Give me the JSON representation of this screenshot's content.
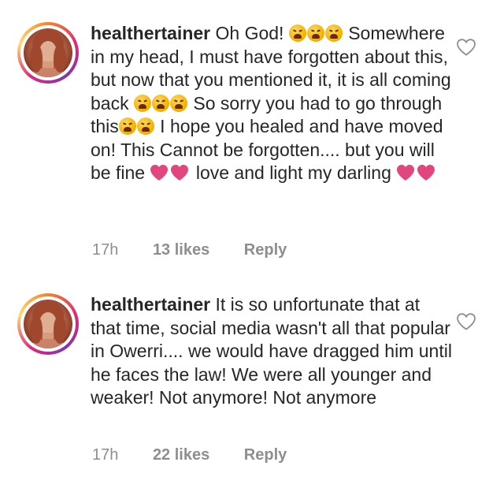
{
  "comments": [
    {
      "username": "healthertainer",
      "segments": [
        {
          "type": "text",
          "value": "Oh God! "
        },
        {
          "type": "emoji",
          "name": "crying-face",
          "count": 3
        },
        {
          "type": "text",
          "value": " Somewhere in my head, I must have forgotten about this, but now that you mentioned it, it is all coming back "
        },
        {
          "type": "emoji",
          "name": "crying-face",
          "count": 3
        },
        {
          "type": "text",
          "value": " So sorry you had to go through this"
        },
        {
          "type": "emoji",
          "name": "crying-face",
          "count": 2
        },
        {
          "type": "text",
          "value": " I hope you healed and have moved on! This Cannot be forgotten.... but you will be fine "
        },
        {
          "type": "heart",
          "count": 2
        },
        {
          "type": "text",
          "value": " love and light my darling "
        },
        {
          "type": "heart",
          "count": 2
        }
      ],
      "time": "17h",
      "likes": "13 likes",
      "reply": "Reply"
    },
    {
      "username": "healthertainer",
      "segments": [
        {
          "type": "text",
          "value": "It is so unfortunate that at that time, social media wasn't all that popular in Owerri.... we would have dragged him until he faces the law! We were all younger and weaker! Not anymore! Not anymore"
        }
      ],
      "time": "17h",
      "likes": "22 likes",
      "reply": "Reply"
    }
  ],
  "colors": {
    "heart": "#e2467f",
    "meta": "#8e8e8e",
    "text": "#262626"
  },
  "icons": {
    "like": "heart-outline-icon",
    "emoji": "crying-face-icon"
  }
}
